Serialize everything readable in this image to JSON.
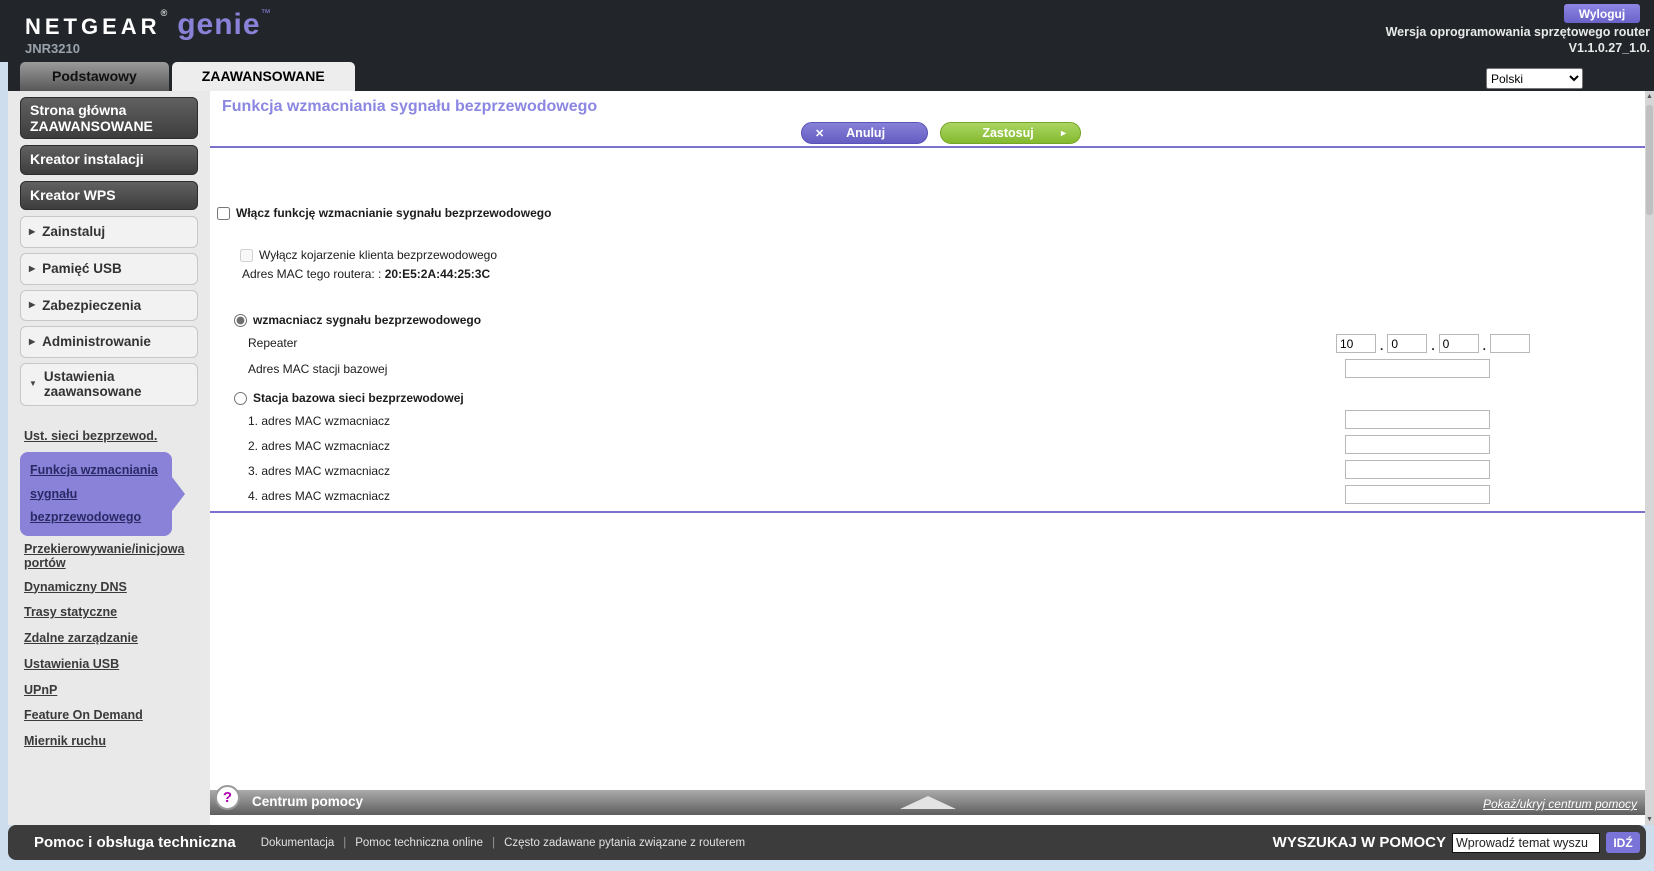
{
  "colors": {
    "accent_purple": "#8982d8",
    "title_purple": "#8b87e2",
    "button_purple": "#6a62c8",
    "button_green": "#8dc63f",
    "divider_purple": "#7a72cc",
    "header_bg": "#22262a",
    "footer_bg": "#3c3c3c",
    "page_bg": "#cddded",
    "sidebar_bg": "#e9e9e9",
    "help_icon_magenta": "#b300b3"
  },
  "icons": {
    "cancel_x": "✕",
    "apply_arrow": "►",
    "section_collapsed": "▶",
    "section_expanded": "▼",
    "help_question": "?",
    "scroll_up": "▲",
    "scroll_down": "▼",
    "ip_separator": "."
  },
  "header": {
    "brand": "NETGEAR",
    "reg_mark": "®",
    "product": "genie",
    "tm_mark": "™",
    "model": "JNR3210",
    "logout_label": "Wyloguj",
    "firmware_label": "Wersja oprogramowania sprzętowego router",
    "firmware_version": "V1.1.0.27_1.0."
  },
  "tabs": {
    "basic_label": "Podstawowy",
    "advanced_label": "ZAAWANSOWANE",
    "language_selected": "Polski"
  },
  "sidebar": {
    "home_line1": "Strona główna",
    "home_line2": "ZAAWANSOWANE",
    "wizard_label": "Kreator instalacji",
    "wps_label": "Kreator WPS",
    "sections": [
      {
        "label": "Zainstaluj"
      },
      {
        "label": "Pamięć USB"
      },
      {
        "label": "Zabezpieczenia"
      },
      {
        "label": "Administrowanie"
      }
    ],
    "expanded_section": {
      "line1": "Ustawienia",
      "line2": "zaawansowane"
    },
    "submenu": [
      {
        "lines": [
          "Ust. sieci bezprzewod."
        ]
      },
      {
        "lines": [
          "Funkcja wzmacniania",
          "sygnału",
          "bezprzewodowego"
        ],
        "active": true
      },
      {
        "lines": [
          "Przekierowywanie/inicjowa",
          "portów"
        ]
      },
      {
        "lines": [
          "Dynamiczny DNS"
        ]
      },
      {
        "lines": [
          "Trasy statyczne"
        ]
      },
      {
        "lines": [
          "Zdalne zarządzanie"
        ]
      },
      {
        "lines": [
          "Ustawienia USB"
        ]
      },
      {
        "lines": [
          "UPnP"
        ]
      },
      {
        "lines": [
          "Feature On Demand"
        ]
      },
      {
        "lines": [
          "Miernik ruchu"
        ]
      }
    ]
  },
  "main": {
    "title": "Funkcja wzmacniania sygnału bezprzewodowego",
    "cancel_label": "Anuluj",
    "apply_label": "Zastosuj",
    "enable_label": "Włącz funkcję wzmacnianie sygnału bezprzewodowego",
    "disable_association_label": "Wyłącz kojarzenie klienta bezprzewodowego",
    "router_mac_label": "Adres MAC tego routera: :",
    "router_mac": "20:E5:2A:44:25:3C",
    "repeater_option_label": "wzmacniacz sygnału bezprzewodowego",
    "repeater_ip_label": "Repeater",
    "repeater_ip": [
      "10",
      "0",
      "0",
      ""
    ],
    "base_mac_label": "Adres MAC stacji bazowej",
    "base_mac_value": "",
    "base_option_label": "Stacja bazowa sieci bezprzewodowej",
    "repeater_mac_rows": [
      {
        "label": "1. adres MAC wzmacniacz",
        "value": ""
      },
      {
        "label": "2. adres MAC wzmacniacz",
        "value": ""
      },
      {
        "label": "3. adres MAC wzmacniacz",
        "value": ""
      },
      {
        "label": "4. adres MAC wzmacniacz",
        "value": ""
      }
    ]
  },
  "help_bar": {
    "title": "Centrum pomocy",
    "toggle_label": "Pokaż/ukryj centrum pomocy"
  },
  "footer": {
    "support_title": "Pomoc i obsługa techniczna",
    "separator": "|",
    "links": [
      "Dokumentacja",
      "Pomoc techniczna online",
      "Często zadawane pytania związane z routerem"
    ],
    "search_label": "WYSZUKAJ W POMOCY",
    "search_placeholder": "Wprowadź temat wyszu",
    "go_label": "IDŹ"
  }
}
